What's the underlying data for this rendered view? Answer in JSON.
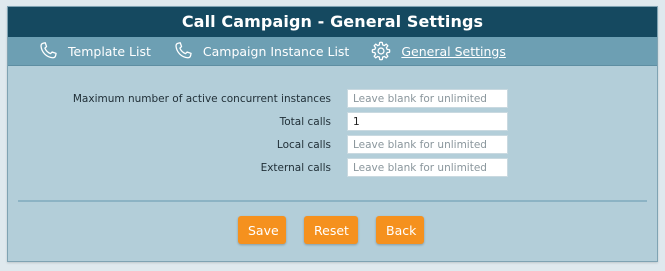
{
  "window": {
    "title": "Call Campaign - General Settings"
  },
  "nav": {
    "items": [
      {
        "label": "Template List",
        "icon": "phone-icon",
        "active": false
      },
      {
        "label": "Campaign Instance List",
        "icon": "phone-icon",
        "active": false
      },
      {
        "label": "General Settings",
        "icon": "gear-icon",
        "active": true
      }
    ]
  },
  "form": {
    "fields": [
      {
        "label": "Maximum number of active concurrent instances",
        "value": "",
        "placeholder": "Leave blank for unlimited"
      },
      {
        "label": "Total calls",
        "value": "1",
        "placeholder": ""
      },
      {
        "label": "Local calls",
        "value": "",
        "placeholder": "Leave blank for unlimited"
      },
      {
        "label": "External calls",
        "value": "",
        "placeholder": "Leave blank for unlimited"
      }
    ]
  },
  "buttons": {
    "save": "Save",
    "reset": "Reset",
    "back": "Back"
  },
  "colors": {
    "title_bar": "#154960",
    "nav_bar": "#6d9fb3",
    "panel": "#b3ced9",
    "button": "#f5911e"
  }
}
